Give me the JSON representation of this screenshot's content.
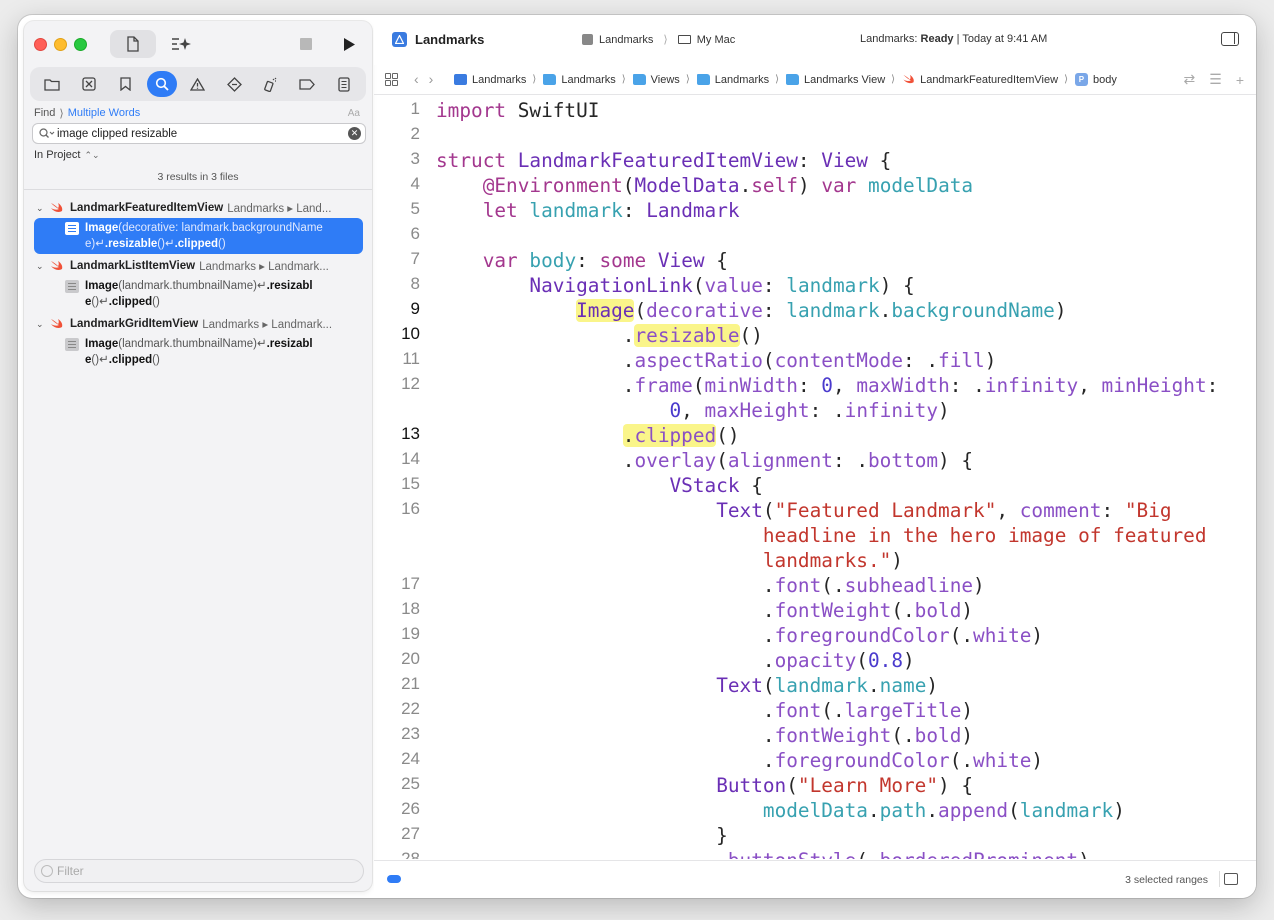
{
  "toolbar": {
    "project_title": "Landmarks",
    "scheme": "Landmarks",
    "destination": "My Mac",
    "status_prefix": "Landmarks: ",
    "status_state": "Ready",
    "status_suffix": " | Today at 9:41 AM"
  },
  "find": {
    "label": "Find",
    "mode": "Multiple Words",
    "case_toggle": "Aa",
    "query": "image clipped resizable",
    "scope": "In Project",
    "summary": "3 results in 3 files"
  },
  "results": [
    {
      "file": "LandmarkFeaturedItemView",
      "path": "Landmarks ▸ Land...",
      "match": {
        "a": "Image",
        "b": "(decorative: landmark.backgroundName\ne)↵",
        "c": ".resizable",
        "d": "()↵",
        "e": ".clipped",
        "f": "()"
      }
    },
    {
      "file": "LandmarkListItemView",
      "path": "Landmarks ▸ Landmark...",
      "match": {
        "a": "Image",
        "b": "(landmark.thumbnailName)↵",
        "c": ".resizabl\ne",
        "d": "()↵",
        "e": ".clipped",
        "f": "()"
      }
    },
    {
      "file": "LandmarkGridItemView",
      "path": "Landmarks ▸ Landmark...",
      "match": {
        "a": "Image",
        "b": "(landmark.thumbnailName)↵",
        "c": ".resizabl\ne",
        "d": "()↵",
        "e": ".clipped",
        "f": "()"
      }
    }
  ],
  "filter_placeholder": "Filter",
  "breadcrumbs": [
    "Landmarks",
    "Landmarks",
    "Views",
    "Landmarks",
    "Landmarks View",
    "LandmarkFeaturedItemView",
    "body"
  ],
  "line_numbers": [
    "1",
    "2",
    "3",
    "4",
    "5",
    "6",
    "7",
    "8",
    "9",
    "10",
    "11",
    "12",
    "",
    "13",
    "14",
    "15",
    "16",
    "",
    "",
    "17",
    "18",
    "19",
    "20",
    "21",
    "22",
    "23",
    "24",
    "25",
    "26",
    "27",
    "28"
  ],
  "highlighted_lines": [
    "9",
    "10",
    "13"
  ],
  "bottom_status": "3 selected ranges",
  "colors": {
    "accent": "#2f7cf6",
    "match_highlight": "#faf58a",
    "keyword": "#a3378e",
    "string": "#c2362d",
    "property": "#37a1b0"
  }
}
